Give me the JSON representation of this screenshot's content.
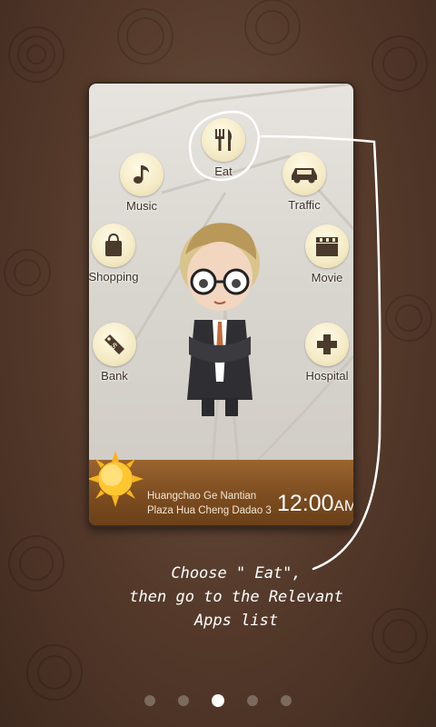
{
  "apps": [
    {
      "label": "Eat",
      "icon": "fork-knife-icon"
    },
    {
      "label": "Music",
      "icon": "music-note-icon"
    },
    {
      "label": "Traffic",
      "icon": "car-icon"
    },
    {
      "label": "Shopping",
      "icon": "shopping-bag-icon"
    },
    {
      "label": "Movie",
      "icon": "clapperboard-icon"
    },
    {
      "label": "Bank",
      "icon": "money-tag-icon"
    },
    {
      "label": "Hospital",
      "icon": "cross-icon"
    }
  ],
  "status": {
    "address_line1": "Huangchao Ge Nantian",
    "address_line2": "Plaza Hua Cheng Dadao 3",
    "time": "12:00",
    "ampm": "AM",
    "weather_icon": "sun-icon"
  },
  "guide": {
    "line1": "Choose \" Eat\",",
    "line2": "then go to the Relevant",
    "line3": "Apps list"
  },
  "pager": {
    "count": 5,
    "active": 3
  }
}
